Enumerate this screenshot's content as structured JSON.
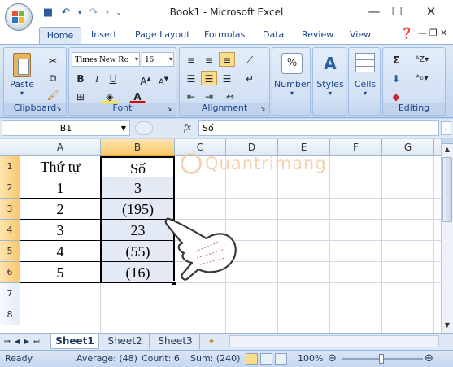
{
  "app": {
    "title": "Book1 - Microsoft Excel"
  },
  "ribbon_tabs": [
    "Home",
    "Insert",
    "Page Layout",
    "Formulas",
    "Data",
    "Review",
    "View"
  ],
  "font": {
    "name": "Times New Ro",
    "size": "16"
  },
  "groups": {
    "clipboard": "Clipboard",
    "font": "Font",
    "alignment": "Alignment",
    "editing": "Editing"
  },
  "buttons": {
    "paste": "Paste",
    "number": "Number",
    "styles": "Styles",
    "cells": "Cells",
    "bold": "B",
    "italic": "I",
    "underline": "U"
  },
  "formula_bar": {
    "name_box": "B1",
    "fx": "fx",
    "content": "Số"
  },
  "columns": [
    "A",
    "B",
    "C",
    "D",
    "E",
    "F",
    "G"
  ],
  "rows": [
    "1",
    "2",
    "3",
    "4",
    "5",
    "6",
    "7",
    "8"
  ],
  "cells": {
    "header_a": "Thứ tự",
    "header_b": "Số",
    "a": [
      "1",
      "2",
      "3",
      "4",
      "5"
    ],
    "b": [
      "3",
      "(195)",
      "23",
      "(55)",
      "(16)"
    ]
  },
  "watermark": "Quantrimang",
  "sheets": [
    "Sheet1",
    "Sheet2",
    "Sheet3"
  ],
  "status": {
    "ready": "Ready",
    "average": "Average: (48)",
    "count": "Count: 6",
    "sum": "Sum: (240)",
    "zoom": "100%"
  },
  "colors": {
    "ribbon": "#dfe9f5",
    "selection": "#e4e9f6",
    "accent": "#15428b"
  }
}
